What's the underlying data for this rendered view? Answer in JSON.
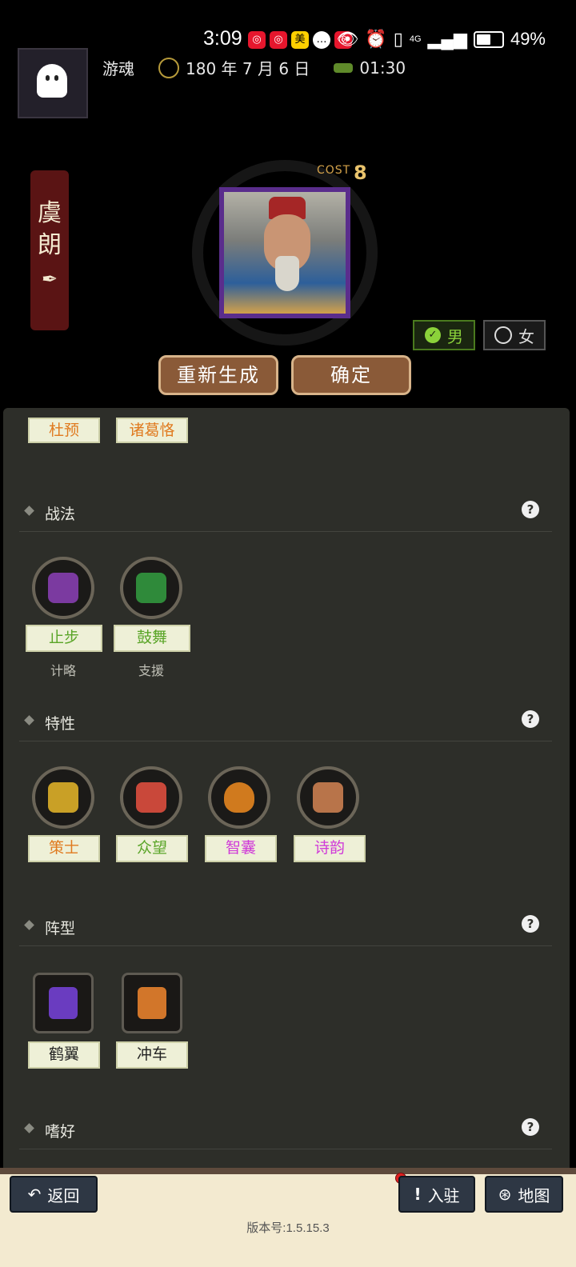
{
  "status_bar": {
    "time": "3:09",
    "notif_badge": "美",
    "battery_text": "49%",
    "network": "4G"
  },
  "header": {
    "player_name": "游魂",
    "date": "180 年 7 月 6 日",
    "clock": "01:30"
  },
  "hero": {
    "name_chars": [
      "虞",
      "朗"
    ],
    "cost_label": "COST",
    "cost_value": "8"
  },
  "gender": {
    "male_label": "男",
    "female_label": "女",
    "selected": "male"
  },
  "actions": {
    "regenerate_label": "重新生成",
    "confirm_label": "确定"
  },
  "related_tags": [
    {
      "label": "杜预",
      "color": "#e07a1f"
    },
    {
      "label": "诸葛恪",
      "color": "#e07a1f"
    }
  ],
  "sections": {
    "tactics": {
      "title": "战法",
      "items": [
        {
          "label": "止步",
          "sub": "计略",
          "color": "#5aa528",
          "icon": "boot-icon"
        },
        {
          "label": "鼓舞",
          "sub": "支援",
          "color": "#5aa528",
          "icon": "cheer-icon"
        }
      ]
    },
    "traits": {
      "title": "特性",
      "items": [
        {
          "label": "策士",
          "color": "#e07a1f",
          "icon": "strategist-hat-icon"
        },
        {
          "label": "众望",
          "color": "#5aa528",
          "icon": "crowd-icon"
        },
        {
          "label": "智囊",
          "color": "#d03ad8",
          "icon": "pouch-icon"
        },
        {
          "label": "诗韵",
          "color": "#d03ad8",
          "icon": "scroll-icon"
        }
      ]
    },
    "formation": {
      "title": "阵型",
      "items": [
        {
          "label": "鹤翼",
          "color": "#222222",
          "icon": "helmet-icon"
        },
        {
          "label": "冲车",
          "color": "#222222",
          "icon": "trojan-horse-icon"
        }
      ]
    },
    "hobby": {
      "title": "嗜好"
    }
  },
  "help_glyph": "?",
  "bottom_nav": {
    "back_label": "返回",
    "settle_label": "入驻",
    "map_label": "地图",
    "version": "版本号:1.5.15.3"
  }
}
